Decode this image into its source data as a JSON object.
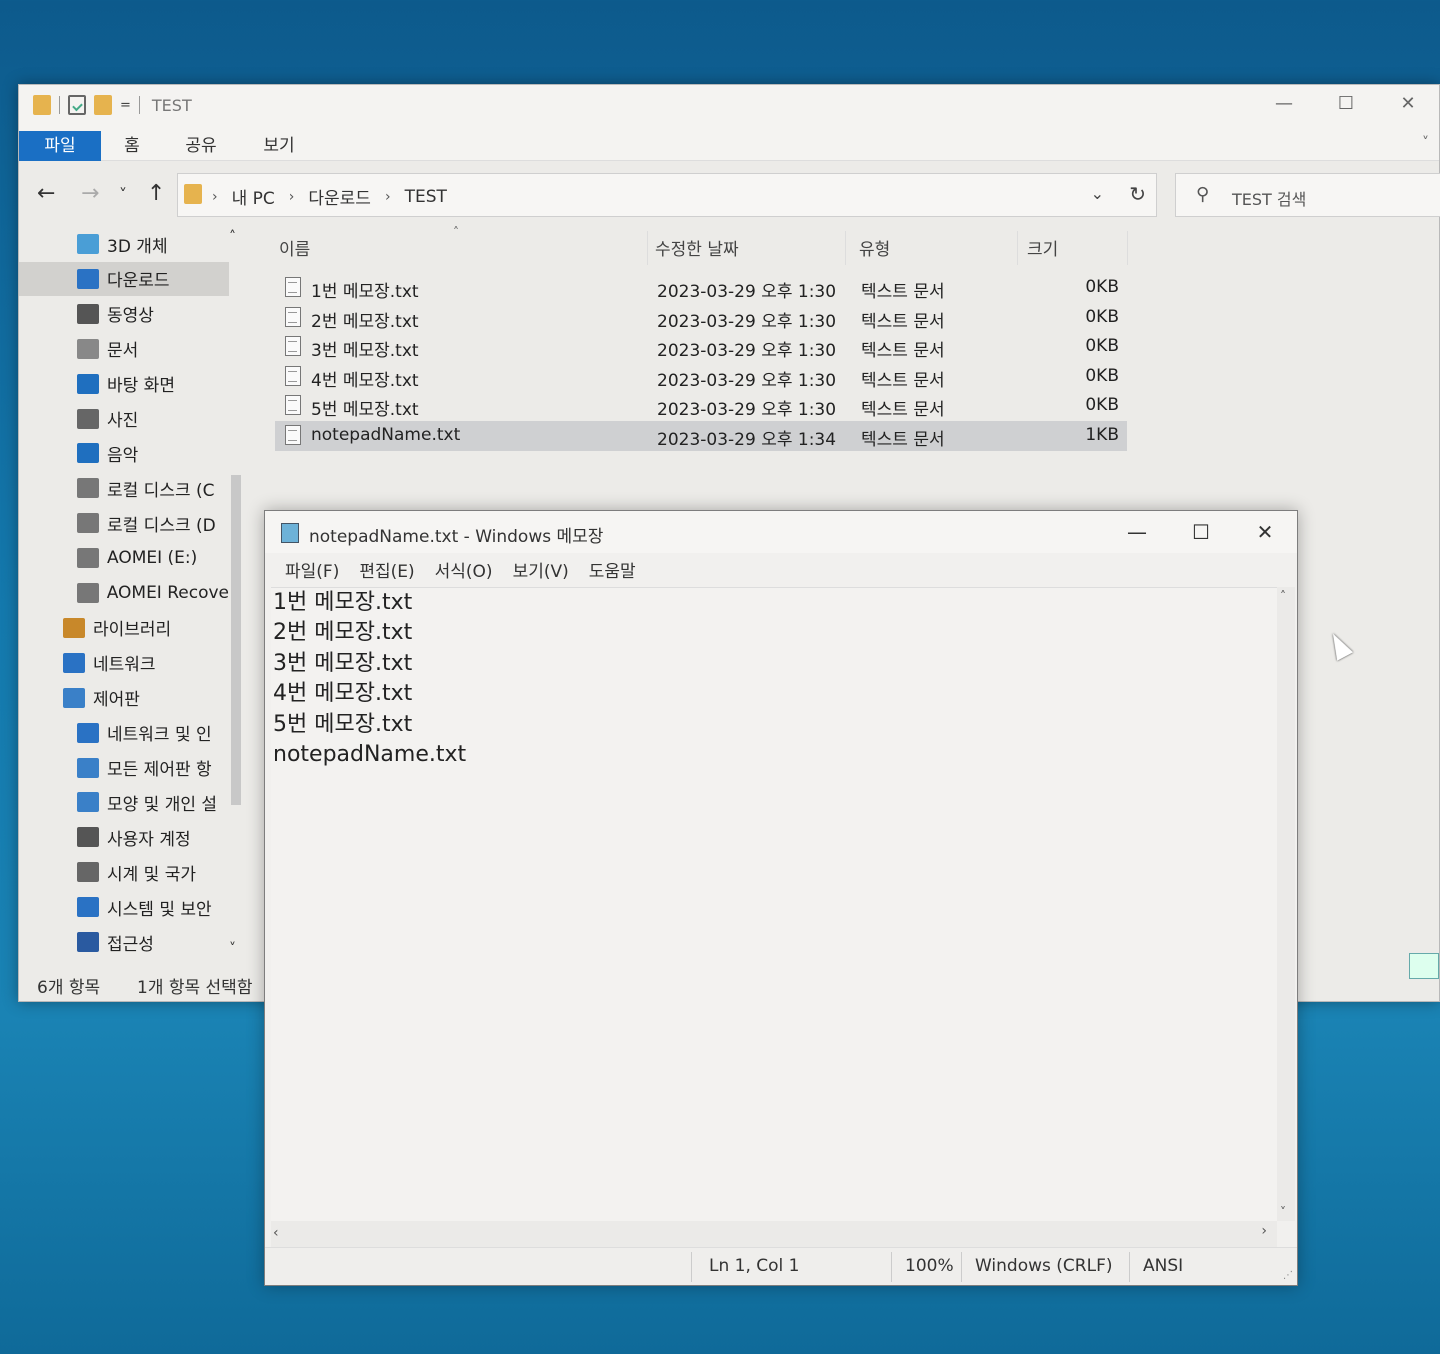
{
  "explorer": {
    "title": "TEST",
    "qa_dropdown": "=",
    "ribbon_tabs": [
      "파일",
      "홈",
      "공유",
      "보기"
    ],
    "nav_buttons": {
      "back": "←",
      "forward": "→",
      "recent": "˅",
      "up": "↑"
    },
    "breadcrumb": [
      "내 PC",
      "다운로드",
      "TEST"
    ],
    "breadcrumb_sep": "›",
    "search_placeholder": "TEST 검색",
    "nav_items": [
      {
        "label": "3D 개체",
        "icon": "3d-objects-icon",
        "color": "#4a9ed6"
      },
      {
        "label": "다운로드",
        "icon": "downloads-icon",
        "color": "#2a72c4",
        "selected": true
      },
      {
        "label": "동영상",
        "icon": "videos-icon",
        "color": "#555555"
      },
      {
        "label": "문서",
        "icon": "documents-icon",
        "color": "#888888"
      },
      {
        "label": "바탕 화면",
        "icon": "desktop-icon",
        "color": "#1f6fbf"
      },
      {
        "label": "사진",
        "icon": "pictures-icon",
        "color": "#666666"
      },
      {
        "label": "음악",
        "icon": "music-icon",
        "color": "#1f6fbf"
      },
      {
        "label": "로컬 디스크 (C",
        "icon": "drive-c-icon",
        "color": "#777777"
      },
      {
        "label": "로컬 디스크 (D",
        "icon": "drive-d-icon",
        "color": "#777777"
      },
      {
        "label": "AOMEI (E:)",
        "icon": "drive-e-icon",
        "color": "#777777"
      },
      {
        "label": "AOMEI Recove",
        "icon": "drive-recovery-icon",
        "color": "#777777"
      },
      {
        "label": "라이브러리",
        "icon": "libraries-icon",
        "color": "#c8882a"
      },
      {
        "label": "네트워크",
        "icon": "network-icon",
        "color": "#2a72c4"
      },
      {
        "label": "제어판",
        "icon": "control-panel-icon",
        "color": "#3a80c8"
      },
      {
        "label": "네트워크 및 인",
        "icon": "network-internet-icon",
        "color": "#2a72c4"
      },
      {
        "label": "모든 제어판 항",
        "icon": "all-control-panel-icon",
        "color": "#3a80c8"
      },
      {
        "label": "모양 및 개인 설",
        "icon": "appearance-icon",
        "color": "#3a80c8"
      },
      {
        "label": "사용자 계정",
        "icon": "user-accounts-icon",
        "color": "#555555"
      },
      {
        "label": "시계 및 국가",
        "icon": "clock-region-icon",
        "color": "#666666"
      },
      {
        "label": "시스템 및 보안",
        "icon": "system-security-icon",
        "color": "#2a72c4"
      },
      {
        "label": "접근성",
        "icon": "accessibility-icon",
        "color": "#2a5aa0"
      }
    ],
    "columns": {
      "name": "이름",
      "date": "수정한 날짜",
      "type": "유형",
      "size": "크기"
    },
    "files": [
      {
        "name": "1번 메모장.txt",
        "date": "2023-03-29 오후 1:30",
        "type": "텍스트 문서",
        "size": "0KB"
      },
      {
        "name": "2번 메모장.txt",
        "date": "2023-03-29 오후 1:30",
        "type": "텍스트 문서",
        "size": "0KB"
      },
      {
        "name": "3번 메모장.txt",
        "date": "2023-03-29 오후 1:30",
        "type": "텍스트 문서",
        "size": "0KB"
      },
      {
        "name": "4번 메모장.txt",
        "date": "2023-03-29 오후 1:30",
        "type": "텍스트 문서",
        "size": "0KB"
      },
      {
        "name": "5번 메모장.txt",
        "date": "2023-03-29 오후 1:30",
        "type": "텍스트 문서",
        "size": "0KB"
      },
      {
        "name": "notepadName.txt",
        "date": "2023-03-29 오후 1:34",
        "type": "텍스트 문서",
        "size": "1KB",
        "selected": true
      }
    ],
    "status": {
      "count": "6개 항목",
      "selection": "1개 항목 선택함"
    }
  },
  "notepad": {
    "title": "notepadName.txt - Windows 메모장",
    "menu": [
      "파일(F)",
      "편집(E)",
      "서식(O)",
      "보기(V)",
      "도움말"
    ],
    "lines": [
      "1번 메모장.txt",
      "2번 메모장.txt",
      "3번 메모장.txt",
      "4번 메모장.txt",
      "5번 메모장.txt",
      "notepadName.txt"
    ],
    "status": {
      "position": "Ln 1, Col 1",
      "zoom": "100%",
      "line_ending": "Windows (CRLF)",
      "encoding": "ANSI"
    }
  },
  "colors": {
    "accent": "#1a6fc4",
    "desktop": "#1479ad",
    "selection": "#cfd0d2"
  }
}
